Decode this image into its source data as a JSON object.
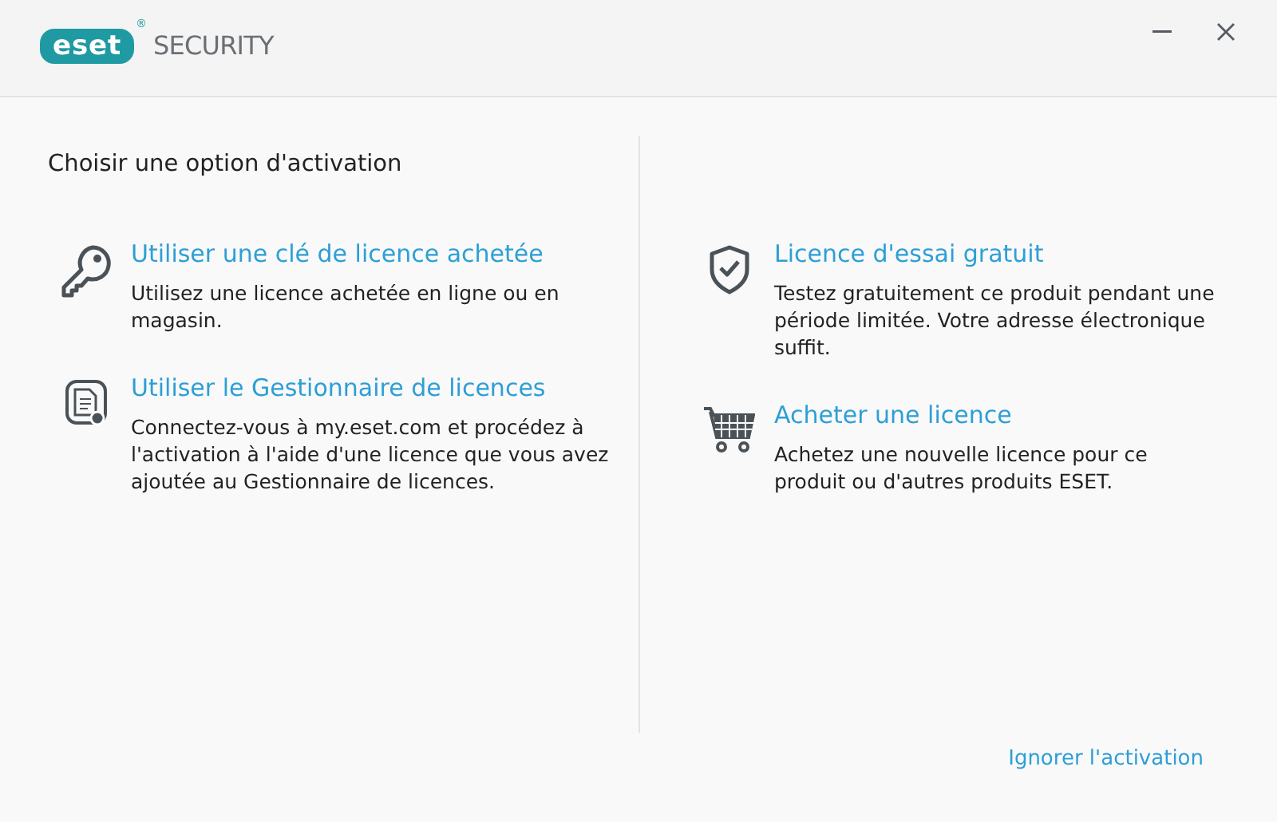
{
  "header": {
    "logo": "eset",
    "logo_mark": "®",
    "product": "SECURITY"
  },
  "window_controls": [
    {
      "kind": "minimize"
    },
    {
      "kind": "close"
    }
  ],
  "heading": "Choisir une option d'activation",
  "columns": [
    {
      "options": [
        {
          "kind": "key",
          "title": "Utiliser une clé de licence achetée",
          "description": "Utilisez une licence achetée en ligne ou en magasin."
        },
        {
          "kind": "manager",
          "title": "Utiliser le Gestionnaire de licences",
          "description": "Connectez-vous à my.eset.com et procédez à l'activation à l'aide d'une licence que vous avez ajoutée au Gestionnaire de licences."
        }
      ]
    },
    {
      "options": [
        {
          "kind": "shield",
          "title": "Licence d'essai gratuit",
          "description": "Testez gratuitement ce produit pendant une période limitée. Votre adresse électronique suffit."
        },
        {
          "kind": "cart",
          "title": "Acheter une licence",
          "description": "Achetez une nouvelle licence pour ce produit ou d'autres produits ESET."
        }
      ]
    }
  ],
  "skip_link": "Ignorer l'activation"
}
